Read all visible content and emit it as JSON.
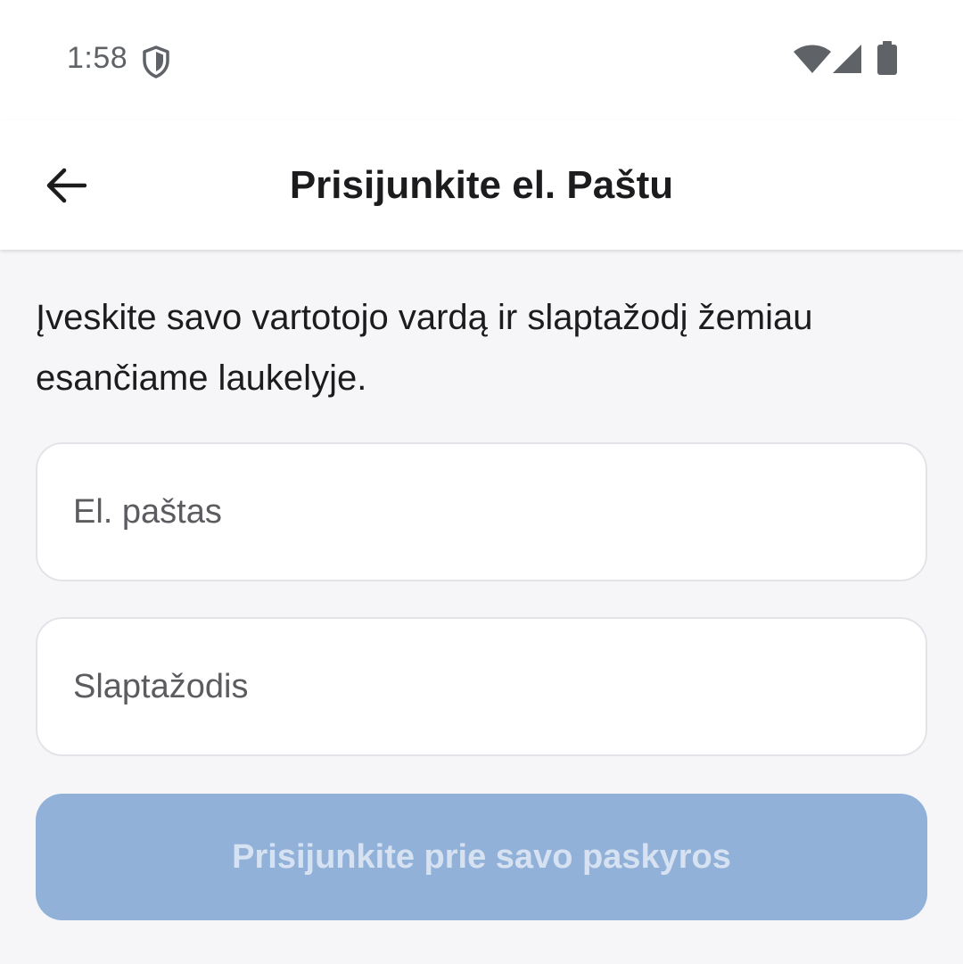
{
  "status_bar": {
    "time": "1:58",
    "icons": [
      "shield-icon",
      "wifi-icon",
      "signal-icon",
      "battery-icon"
    ]
  },
  "header": {
    "title": "Prisijunkite el. Paštu",
    "back_icon": "arrow-left-icon"
  },
  "form": {
    "instructions": "Įveskite savo vartotojo vardą ir slaptažodį žemiau esančiame laukelyje.",
    "email": {
      "value": "",
      "placeholder": "El. paštas"
    },
    "password": {
      "value": "",
      "placeholder": "Slaptažodis"
    },
    "submit_label": "Prisijunkite prie savo paskyros",
    "submit_enabled": false
  },
  "colors": {
    "app_bar_bg": "#ffffff",
    "content_bg": "#f6f6f8",
    "button_disabled_bg": "#92b1d9",
    "button_disabled_text": "#d6e2f1"
  }
}
